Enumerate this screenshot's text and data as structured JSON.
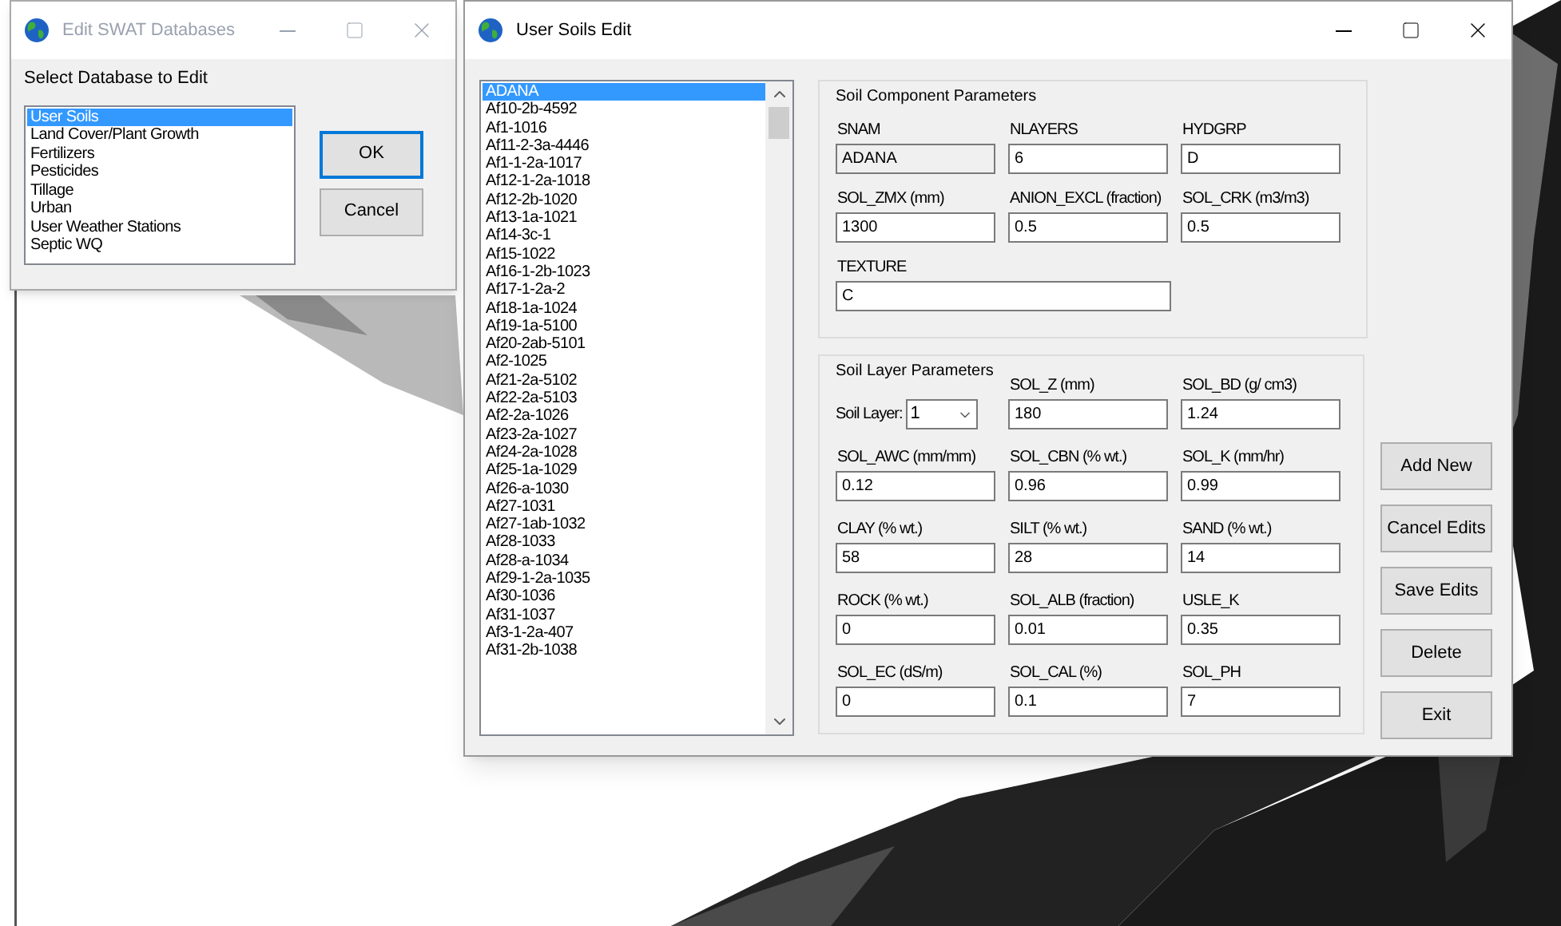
{
  "db_window": {
    "title": "Edit SWAT Databases",
    "prompt": "Select Database to Edit",
    "items": [
      {
        "label": "User Soils",
        "selected": true
      },
      {
        "label": "Land Cover/Plant Growth",
        "selected": false
      },
      {
        "label": "Fertilizers",
        "selected": false
      },
      {
        "label": "Pesticides",
        "selected": false
      },
      {
        "label": "Tillage",
        "selected": false
      },
      {
        "label": "Urban",
        "selected": false
      },
      {
        "label": "User Weather Stations",
        "selected": false
      },
      {
        "label": "Septic WQ",
        "selected": false
      }
    ],
    "buttons": [
      {
        "label": "OK",
        "default": true
      },
      {
        "label": "Cancel",
        "default": false
      }
    ]
  },
  "soils_window": {
    "title": "User Soils Edit",
    "soil_list": [
      {
        "label": "ADANA",
        "selected": true
      },
      {
        "label": "Af10-2b-4592",
        "selected": false
      },
      {
        "label": "Af1-1016",
        "selected": false
      },
      {
        "label": "Af11-2-3a-4446",
        "selected": false
      },
      {
        "label": "Af1-1-2a-1017",
        "selected": false
      },
      {
        "label": "Af12-1-2a-1018",
        "selected": false
      },
      {
        "label": "Af12-2b-1020",
        "selected": false
      },
      {
        "label": "Af13-1a-1021",
        "selected": false
      },
      {
        "label": "Af14-3c-1",
        "selected": false
      },
      {
        "label": "Af15-1022",
        "selected": false
      },
      {
        "label": "Af16-1-2b-1023",
        "selected": false
      },
      {
        "label": "Af17-1-2a-2",
        "selected": false
      },
      {
        "label": "Af18-1a-1024",
        "selected": false
      },
      {
        "label": "Af19-1a-5100",
        "selected": false
      },
      {
        "label": "Af20-2ab-5101",
        "selected": false
      },
      {
        "label": "Af2-1025",
        "selected": false
      },
      {
        "label": "Af21-2a-5102",
        "selected": false
      },
      {
        "label": "Af22-2a-5103",
        "selected": false
      },
      {
        "label": "Af2-2a-1026",
        "selected": false
      },
      {
        "label": "Af23-2a-1027",
        "selected": false
      },
      {
        "label": "Af24-2a-1028",
        "selected": false
      },
      {
        "label": "Af25-1a-1029",
        "selected": false
      },
      {
        "label": "Af26-a-1030",
        "selected": false
      },
      {
        "label": "Af27-1031",
        "selected": false
      },
      {
        "label": "Af27-1ab-1032",
        "selected": false
      },
      {
        "label": "Af28-1033",
        "selected": false
      },
      {
        "label": "Af28-a-1034",
        "selected": false
      },
      {
        "label": "Af29-1-2a-1035",
        "selected": false
      },
      {
        "label": "Af30-1036",
        "selected": false
      },
      {
        "label": "Af31-1037",
        "selected": false
      },
      {
        "label": "Af3-1-2a-407",
        "selected": false
      },
      {
        "label": "Af31-2b-1038",
        "selected": false
      }
    ],
    "component": {
      "title": "Soil Component Parameters",
      "fields": [
        {
          "label": "SNAM",
          "value": "ADANA",
          "kind": "readonly"
        },
        {
          "label": "NLAYERS",
          "value": "6",
          "kind": "text"
        },
        {
          "label": "HYDGRP",
          "value": "D",
          "kind": "text"
        },
        {
          "label": "SOL_ZMX (mm)",
          "value": "1300",
          "kind": "text"
        },
        {
          "label": "ANION_EXCL (fraction)",
          "value": "0.5",
          "kind": "text"
        },
        {
          "label": "SOL_CRK (m3/m3)",
          "value": "0.5",
          "kind": "text"
        },
        {
          "label": "TEXTURE",
          "value": "C",
          "kind": "wide"
        }
      ]
    },
    "layer": {
      "title": "Soil Layer Parameters",
      "layer_select": {
        "label": "Soil Layer:",
        "value": "1"
      },
      "fields": [
        {
          "label": "SOL_Z (mm)",
          "value": "180"
        },
        {
          "label": "SOL_BD (g/ cm3)",
          "value": "1.24"
        },
        {
          "label": "SOL_AWC (mm/mm)",
          "value": "0.12"
        },
        {
          "label": "SOL_CBN (% wt.)",
          "value": "0.96"
        },
        {
          "label": "SOL_K (mm/hr)",
          "value": "0.99"
        },
        {
          "label": "CLAY (% wt.)",
          "value": "58"
        },
        {
          "label": "SILT (% wt.)",
          "value": "28"
        },
        {
          "label": "SAND (% wt.)",
          "value": "14"
        },
        {
          "label": "ROCK (% wt.)",
          "value": "0"
        },
        {
          "label": "SOL_ALB (fraction)",
          "value": "0.01"
        },
        {
          "label": "USLE_K",
          "value": "0.35"
        },
        {
          "label": "SOL_EC (dS/m)",
          "value": "0"
        },
        {
          "label": "SOL_CAL (%)",
          "value": "0.1"
        },
        {
          "label": "SOL_PH",
          "value": "7"
        }
      ]
    },
    "buttons": [
      {
        "label": "Add New"
      },
      {
        "label": "Cancel Edits"
      },
      {
        "label": "Save Edits"
      },
      {
        "label": "Delete"
      },
      {
        "label": "Exit"
      }
    ]
  }
}
